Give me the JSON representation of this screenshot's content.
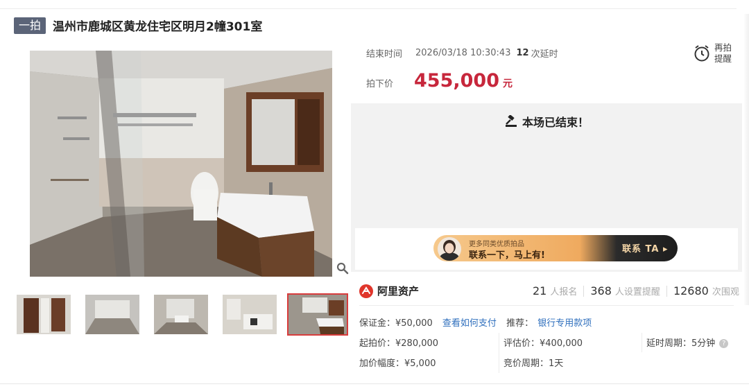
{
  "title": {
    "tag": "一拍",
    "text": "温州市鹿城区黄龙住宅区明月2幢301室"
  },
  "auction": {
    "end_label": "结束时间",
    "end_time": "2026/03/18 10:30:43",
    "extend_count": "12",
    "extend_suffix": "次延时",
    "deal_label": "拍下价",
    "deal_price": "455,000",
    "currency": "元",
    "remind_line1": "再拍",
    "remind_line2": "提醒",
    "ended_text": "本场已结束！"
  },
  "promo": {
    "sub": "更多同类优质拍品",
    "main": "联系一下，马上有!",
    "button": "联系 TA ▸"
  },
  "platform": {
    "name": "阿里资产",
    "logo_icon": "ali-asset-logo-icon"
  },
  "stats": [
    {
      "value": "21",
      "label": "人报名"
    },
    {
      "value": "368",
      "label": "人设置提醒"
    },
    {
      "value": "12680",
      "label": "次围观"
    }
  ],
  "details": {
    "deposit": "保证金：¥50,000",
    "pay_link": "查看如何支付",
    "recommend_label": "推荐：",
    "recommend_link": "银行专用款项",
    "start_price": "起拍价：¥280,000",
    "appraisal": "评估价：¥400,000",
    "delay_period": "延时周期：5分钟",
    "increment": "加价幅度：¥5,000",
    "bid_period": "竞价周期：1天"
  },
  "colors": {
    "price": "#c7273c",
    "link": "#2f6fbd",
    "tag": "#5b6478",
    "selected_thumb": "#d83b3b"
  },
  "gallery": {
    "selected_index": 4,
    "thumb_count": 5
  }
}
